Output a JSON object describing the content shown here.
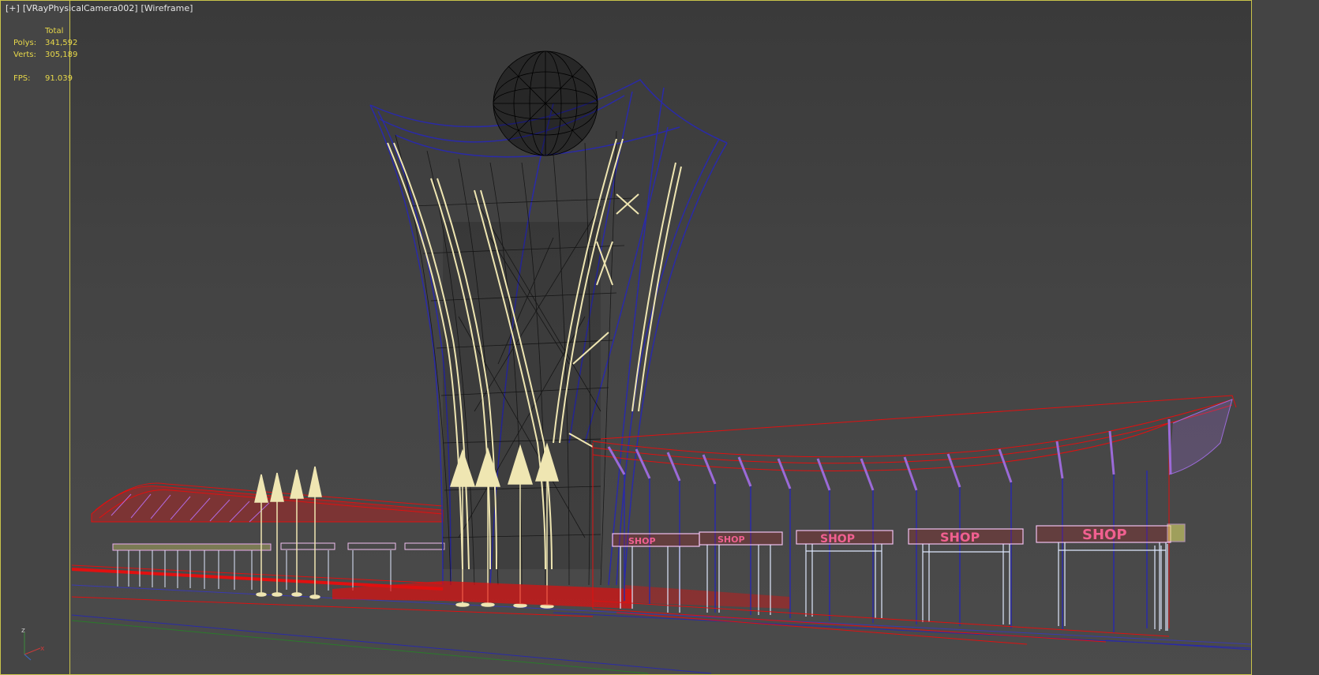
{
  "viewport": {
    "label_plus": "[+]",
    "label_camera": "[VRayPhysicalCamera002]",
    "label_mode": "[Wireframe]"
  },
  "stats": {
    "header": "Total",
    "polys_label": "Polys:",
    "polys_value": "341,592",
    "verts_label": "Verts:",
    "verts_value": "305,189",
    "fps_label": "FPS:",
    "fps_value": "91.039"
  },
  "scene": {
    "shop_signs": [
      "SHOP",
      "SHOP",
      "SHOP",
      "SHOP",
      "SHOP"
    ],
    "axis_gizmo": {
      "z_label": "z",
      "x_label": "x"
    }
  },
  "colors": {
    "frame": "#c9c34a",
    "stats_text": "#e7d84a",
    "wire_blue": "#2a2aa8",
    "wire_red": "#e01010",
    "wire_cream": "#efe6b2",
    "wire_black": "#111111",
    "wire_purple": "#9b6ad8"
  }
}
